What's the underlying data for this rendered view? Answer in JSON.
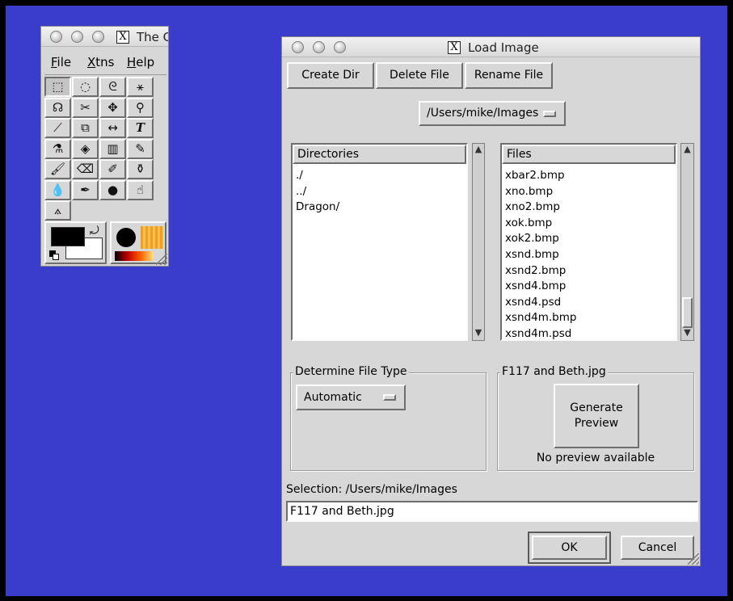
{
  "toolbox": {
    "title": "The G",
    "menu": [
      {
        "underline": "F",
        "rest": "ile"
      },
      {
        "underline": "X",
        "rest": "tns"
      },
      {
        "underline": "H",
        "rest": "elp"
      }
    ],
    "tools": [
      {
        "name": "rect-select",
        "glyph": "⬚"
      },
      {
        "name": "ellipse-select",
        "glyph": "◌"
      },
      {
        "name": "free-select",
        "glyph": "ᘓ"
      },
      {
        "name": "fuzzy-select",
        "glyph": "⚹"
      },
      {
        "name": "bezier-select",
        "glyph": "☊"
      },
      {
        "name": "scissors",
        "glyph": "✂"
      },
      {
        "name": "move",
        "glyph": "✥"
      },
      {
        "name": "magnify",
        "glyph": "⚲"
      },
      {
        "name": "crop",
        "glyph": "⟋"
      },
      {
        "name": "transform",
        "glyph": "⧉"
      },
      {
        "name": "flip",
        "glyph": "↔"
      },
      {
        "name": "text",
        "glyph": "T"
      },
      {
        "name": "color-picker",
        "glyph": "⚗"
      },
      {
        "name": "bucket-fill",
        "glyph": "◈"
      },
      {
        "name": "blend",
        "glyph": "▥"
      },
      {
        "name": "pencil",
        "glyph": "✎"
      },
      {
        "name": "paintbrush",
        "glyph": "🖌"
      },
      {
        "name": "eraser",
        "glyph": "⌫"
      },
      {
        "name": "airbrush",
        "glyph": "✐"
      },
      {
        "name": "clone",
        "glyph": "⚱"
      },
      {
        "name": "blur",
        "glyph": "💧"
      },
      {
        "name": "ink",
        "glyph": "✒"
      },
      {
        "name": "dodge-burn",
        "glyph": "●"
      },
      {
        "name": "smudge",
        "glyph": "☝"
      },
      {
        "name": "measure",
        "glyph": "⟑"
      }
    ],
    "colors": {
      "foreground": "#000000",
      "background": "#ffffff"
    }
  },
  "dialog": {
    "title": "Load Image",
    "buttons": {
      "create_dir": "Create Dir",
      "delete_file": "Delete File",
      "rename_file": "Rename File",
      "ok": "OK",
      "cancel": "Cancel"
    },
    "path_menu": "/Users/mike/Images",
    "directories": {
      "header": "Directories",
      "items": [
        "./",
        "../",
        "Dragon/"
      ]
    },
    "files": {
      "header": "Files",
      "items": [
        "xbar2.bmp",
        "xno.bmp",
        "xno2.bmp",
        "xok.bmp",
        "xok2.bmp",
        "xsnd.bmp",
        "xsnd2.bmp",
        "xsnd4.bmp",
        "xsnd4.psd",
        "xsnd4m.bmp",
        "xsnd4m.psd"
      ]
    },
    "file_type": {
      "label": "Determine File Type",
      "value": "Automatic"
    },
    "preview": {
      "label": "F117 and Beth.jpg",
      "button": "Generate Preview",
      "status": "No preview available"
    },
    "selection": {
      "label": "Selection: /Users/mike/Images",
      "value": "F117 and Beth.jpg"
    }
  }
}
